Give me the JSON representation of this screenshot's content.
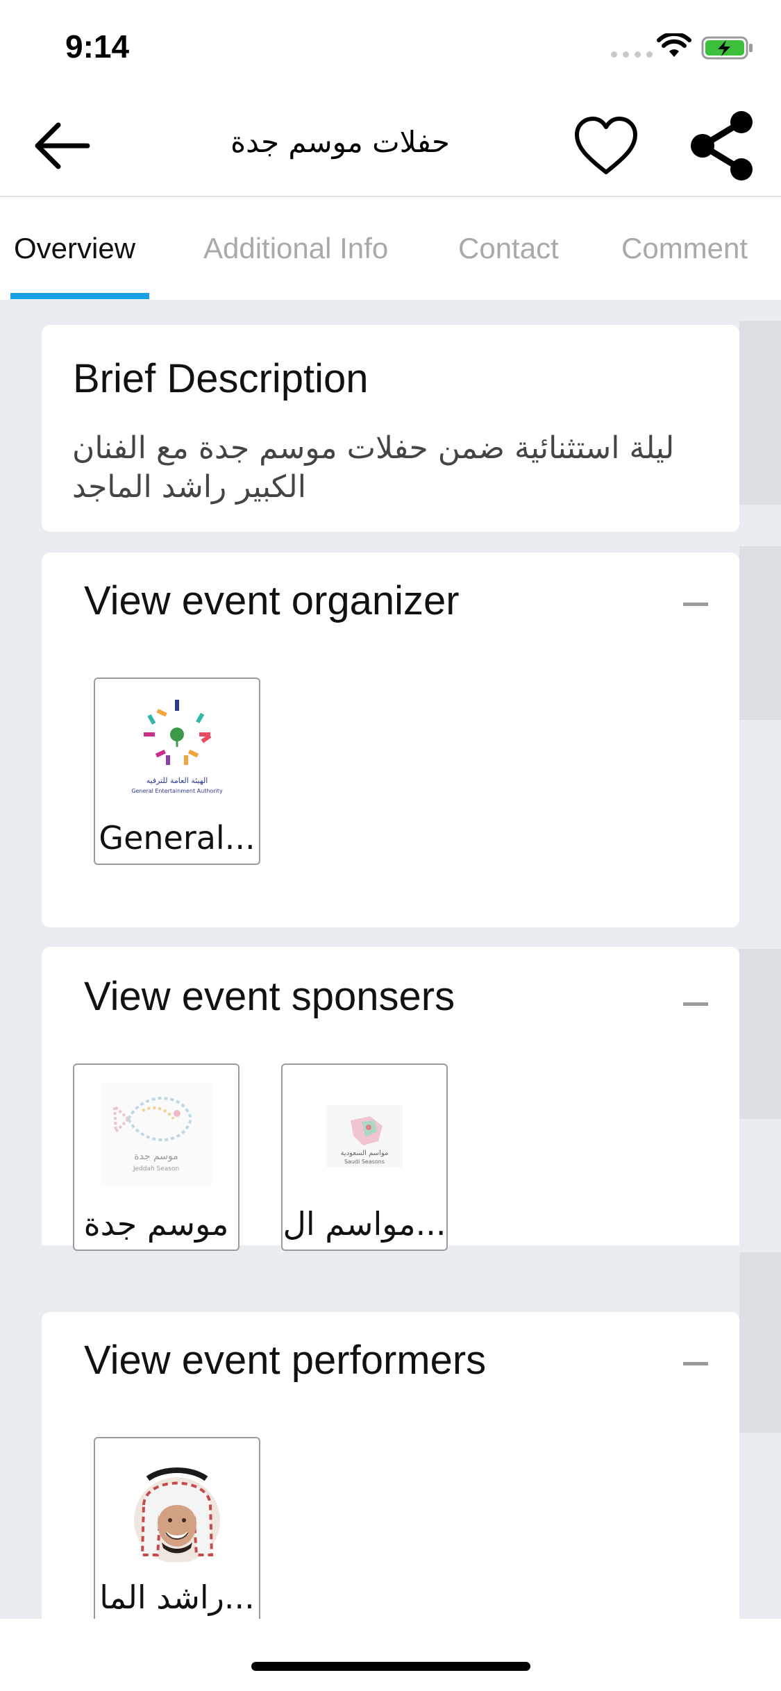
{
  "status_bar": {
    "time": "9:14"
  },
  "header": {
    "title": "حفلات موسم جدة"
  },
  "tabs": [
    {
      "label": "Overview",
      "active": true
    },
    {
      "label": "Additional Info",
      "active": false
    },
    {
      "label": "Contact",
      "active": false
    },
    {
      "label": "Comment",
      "active": false
    }
  ],
  "brief": {
    "title": "Brief Description",
    "text": "ليلة استثنائية ضمن حفلات موسم جدة مع الفنان الكبير راشد الماجد"
  },
  "organizer": {
    "title": "View event organizer",
    "items": [
      {
        "label": "General...",
        "logo_text": "الهيئة العامة للترفيه",
        "logo_subtext": "General Entertainment Authority"
      }
    ]
  },
  "sponsors": {
    "title": "View event sponsers",
    "items": [
      {
        "label": "موسم جدة",
        "logo_text": "موسم جدة",
        "logo_subtext": "Jeddah Season"
      },
      {
        "label": "مواسم ال...",
        "logo_text": "مواسم السعودية",
        "logo_subtext": "Saudi Seasons"
      }
    ]
  },
  "performers": {
    "title": "View event performers",
    "items": [
      {
        "label": "راشد الما..."
      }
    ]
  },
  "colors": {
    "accent": "#1aa0e6",
    "background": "#e9ecf0"
  }
}
